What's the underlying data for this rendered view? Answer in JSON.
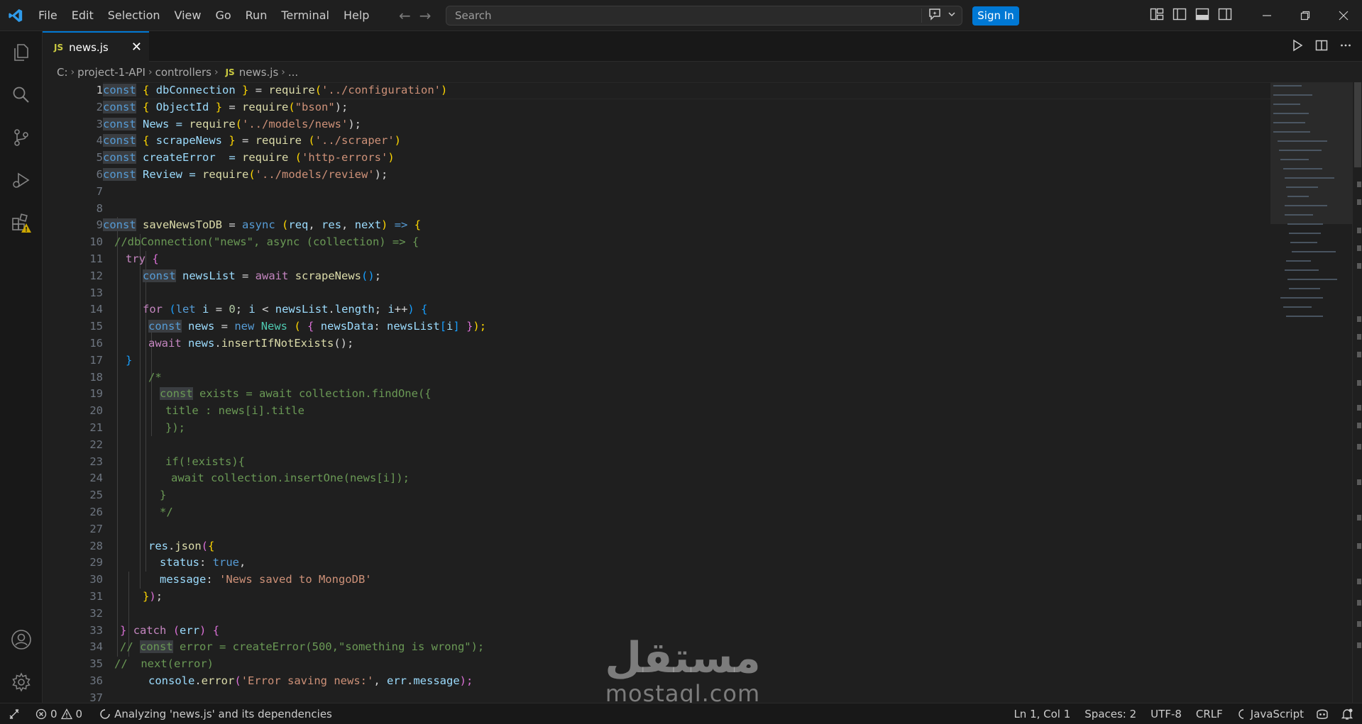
{
  "menu": [
    "File",
    "Edit",
    "Selection",
    "View",
    "Go",
    "Run",
    "Terminal",
    "Help"
  ],
  "search": {
    "placeholder": "Search"
  },
  "signin_label": "Sign In",
  "tab": {
    "badge": "JS",
    "label": "news.js",
    "close": "✕"
  },
  "breadcrumb": {
    "drive": "C:",
    "folder1": "project-1-API",
    "folder2": "controllers",
    "badge": "JS",
    "file": "news.js",
    "more": "..."
  },
  "line_numbers": [
    "1",
    "2",
    "3",
    "4",
    "5",
    "6",
    "7",
    "8",
    "9",
    "10",
    "11",
    "12",
    "13",
    "14",
    "15",
    "16",
    "17",
    "18",
    "19",
    "20",
    "21",
    "22",
    "23",
    "24",
    "25",
    "26",
    "27",
    "28",
    "29",
    "30",
    "31",
    "32",
    "33",
    "34",
    "35",
    "36",
    "37"
  ],
  "code": {
    "l1": [
      "const",
      " ",
      "{",
      " dbConnection ",
      "}",
      " = ",
      "require",
      "(",
      "'../configuration'",
      ")"
    ],
    "l2": [
      "const",
      " ",
      "{",
      " ObjectId ",
      "}",
      " = ",
      "require",
      "(",
      "\"bson\"",
      ");"
    ],
    "l3": [
      "const",
      " News = ",
      "require",
      "(",
      "'../models/news'",
      ");"
    ],
    "l4": [
      "const",
      " ",
      "{",
      " scrapeNews ",
      "}",
      " = ",
      "require",
      " (",
      "'../scraper'",
      ")"
    ],
    "l5": [
      "const",
      " createError  = ",
      "require",
      " (",
      "'http-errors'",
      ")"
    ],
    "l6": [
      "const",
      " Review = ",
      "require",
      "(",
      "'../models/review'",
      ");"
    ],
    "l9": [
      "const",
      " ",
      "saveNewsToDB",
      " = ",
      "async",
      " ",
      "(",
      "req",
      ", ",
      "res",
      ", ",
      "next",
      ")",
      " ",
      "=>",
      " ",
      "{"
    ],
    "l10": "//dbConnection(\"news\", async (collection) => {",
    "l11": [
      "try",
      " ",
      "{"
    ],
    "l12": [
      "const",
      " ",
      "newsList",
      " = ",
      "await",
      " ",
      "scrapeNews",
      "()",
      ";"
    ],
    "l14": [
      "for",
      " ",
      "(",
      "let",
      " ",
      "i",
      " = ",
      "0",
      "; ",
      "i",
      " < ",
      "newsList",
      ".",
      "length",
      "; ",
      "i",
      "++",
      ")",
      " ",
      "{"
    ],
    "l15": [
      "const",
      " ",
      "news",
      " = ",
      "new",
      " ",
      "News",
      " ( ",
      "{",
      " ",
      "newsData",
      ": ",
      "newsList",
      "[",
      "i",
      "]",
      " ",
      "}",
      ");"
    ],
    "l16": [
      "await",
      " ",
      "news",
      ".",
      "insertIfNotExists",
      "();"
    ],
    "l17": "}",
    "l18": "/*",
    "l19": [
      "const",
      " exists = await collection.findOne({"
    ],
    "l20": "title : news[i].title",
    "l21": "});",
    "l23": "if(!exists){",
    "l24": "await collection.insertOne(news[i]);",
    "l25": "}",
    "l26": "*/",
    "l28": [
      "res",
      ".",
      "json",
      "(",
      "{"
    ],
    "l29": [
      "status",
      ": ",
      "true",
      ","
    ],
    "l30": [
      "message",
      ": ",
      "'News saved to MongoDB'"
    ],
    "l31": [
      "}",
      ")",
      ";"
    ],
    "l33": [
      "}",
      " ",
      "catch",
      " ",
      "(",
      "err",
      ")",
      " ",
      "{"
    ],
    "l34": [
      "// ",
      "const",
      " error = createError(500,\"something is wrong\");"
    ],
    "l35": "//  next(error)",
    "l36": [
      "console",
      ".",
      "error",
      "(",
      "'Error saving news:'",
      ", ",
      "err",
      ".",
      "message",
      ");"
    ]
  },
  "status": {
    "errors": "0",
    "warnings": "0",
    "analyzing": "Analyzing 'news.js' and its dependencies",
    "position": "Ln 1, Col 1",
    "spaces": "Spaces: 2",
    "encoding": "UTF-8",
    "eol": "CRLF",
    "language": "JavaScript"
  },
  "watermark": {
    "logo_text": "مستقل",
    "site": "mostaql.com"
  },
  "colors": {
    "accent": "#0078d4",
    "background": "#1f1f1f",
    "sidebar": "#181818",
    "warning": "#cca700"
  },
  "icons": {
    "activity": [
      "explorer-icon",
      "search-icon",
      "source-control-icon",
      "run-debug-icon",
      "extensions-icon",
      "account-icon",
      "settings-gear-icon"
    ],
    "window": [
      "minimize-icon",
      "restore-icon",
      "close-icon"
    ]
  }
}
